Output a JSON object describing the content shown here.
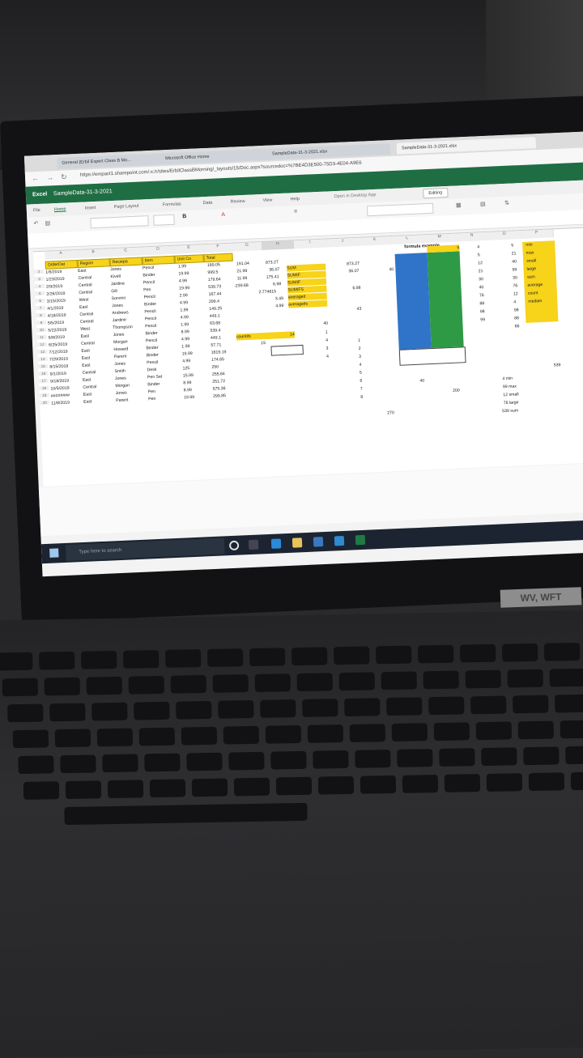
{
  "browser": {
    "tabs": [
      "General (Erbil Expert Class B Mo...",
      "Microsoft Office Home",
      "SampleData-31-3-2021.xlsx",
      "SampleData-31-3-2021.xlsx"
    ],
    "url": "https://empact1.sharepoint.com/:x:/r/sites/ErbilClassBMorning/_layouts/15/Doc.aspx?sourcedoc=%7BE4D3E500-75D3-4E04-A9E6"
  },
  "excel": {
    "app": "Excel",
    "doc_title": "SampleData-31-3-2021",
    "ribbon_tabs": [
      "File",
      "Home",
      "Insert",
      "Page Layout",
      "Formulas",
      "Data",
      "Review",
      "View",
      "Help"
    ],
    "open_desktop": "Open in Desktop App",
    "editing": "Editing",
    "bold": "B",
    "columns": [
      "A",
      "B",
      "C",
      "D",
      "E",
      "F",
      "G",
      "H",
      "I",
      "J",
      "K",
      "L",
      "M",
      "N",
      "O",
      "P"
    ],
    "headers": [
      "OrderDat",
      "Region",
      "Reciepa",
      "Item",
      "Unit Co",
      "Total"
    ],
    "formula_example": "formula example",
    "rows": [
      [
        "1/6/2019",
        "East",
        "Jones",
        "Pencil",
        "1.99",
        "189.05"
      ],
      [
        "1/23/2019",
        "Central",
        "Kivell",
        "Binder",
        "19.99",
        "999.5"
      ],
      [
        "2/9/2019",
        "Central",
        "Jardine",
        "Pencil",
        "4.99",
        "179.64"
      ],
      [
        "2/26/2019",
        "Central",
        "Gill",
        "Pen",
        "19.99",
        "539.73"
      ],
      [
        "3/15/2019",
        "West",
        "Sorvino",
        "Pencil",
        "2.99",
        "167.44"
      ],
      [
        "4/1/2019",
        "East",
        "Jones",
        "Binder",
        "4.99",
        "299.4"
      ],
      [
        "4/18/2019",
        "Central",
        "Andrews",
        "Pencil",
        "1.99",
        "149.25"
      ],
      [
        "5/5/2019",
        "Central",
        "Jardine",
        "Pencil",
        "4.99",
        "449.1"
      ],
      [
        "5/22/2019",
        "West",
        "Thompson",
        "Pencil",
        "1.99",
        "63.68"
      ],
      [
        "6/8/2019",
        "East",
        "Jones",
        "Binder",
        "8.99",
        "539.4"
      ],
      [
        "6/25/2019",
        "Central",
        "Morgan",
        "Pencil",
        "4.99",
        "449.1"
      ],
      [
        "7/12/2019",
        "East",
        "Howard",
        "Binder",
        "1.99",
        "57.71"
      ],
      [
        "7/29/2019",
        "East",
        "Parent",
        "Binder",
        "19.99",
        "1619.19"
      ],
      [
        "8/15/2019",
        "East",
        "Jones",
        "Pencil",
        "4.99",
        "174.65"
      ],
      [
        "9/1/2019",
        "Central",
        "Smith",
        "Desk",
        "125",
        "250"
      ],
      [
        "9/18/2019",
        "East",
        "Jones",
        "Pen Set",
        "15.99",
        "255.84"
      ],
      [
        "10/5/2019",
        "Central",
        "Morgan",
        "Binder",
        "8.99",
        "251.72"
      ],
      [
        "########",
        "East",
        "Jones",
        "Pen",
        "8.99",
        "575.36"
      ],
      [
        "11/8/2019",
        "East",
        "Parent",
        "Pen",
        "19.99",
        "299.85"
      ]
    ],
    "g_values": [
      "191.04",
      "21.99",
      "11.99",
      "-239.68"
    ],
    "h_values": [
      "873.27",
      "36.07",
      "175.41",
      "6.98",
      "2.774615",
      "3.49",
      "4.99"
    ],
    "h_labels": [
      "SUM",
      "SUMIF",
      "SUMIF",
      "SUMIFS",
      "averageif",
      "averageifs"
    ],
    "countifs_label": "countifs",
    "countifs_value": "14",
    "g15": "15",
    "j_values": [
      "873.27",
      "36.07",
      "6.98",
      "43"
    ],
    "k_value": "40",
    "i_column": [
      "40",
      "1",
      "4",
      "3",
      "4"
    ],
    "j_column": [
      "1",
      "2",
      "3",
      "4",
      "5",
      "6",
      "7",
      "8"
    ],
    "n_values": [
      "4",
      "5",
      "12",
      "21",
      "30",
      "40",
      "76",
      "88",
      "98",
      "99"
    ],
    "o_values": [
      "5",
      "21",
      "40",
      "99",
      "30",
      "76",
      "12",
      "4",
      "98",
      "88",
      "66"
    ],
    "p_labels": [
      "min",
      "max",
      "small",
      "large",
      "sum",
      "average",
      "count",
      "median"
    ],
    "misc": {
      "l_40": "40",
      "m_200": "200",
      "k_270": "270",
      "p_539": "539"
    },
    "summary": [
      "4 min",
      "99 max",
      "12 small",
      "76 large",
      "539 sum"
    ],
    "m_top": "5"
  },
  "taskbar": {
    "search_placeholder": "Type here to search"
  },
  "sticker": "WV, WFT"
}
